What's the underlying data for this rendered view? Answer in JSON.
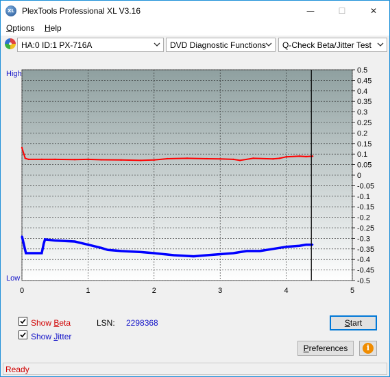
{
  "window": {
    "title": "PlexTools Professional XL V3.16",
    "app_icon_text": "XL",
    "minimize_glyph": "—",
    "maximize_glyph": "☐",
    "close_glyph": "✕"
  },
  "menu": {
    "items": [
      {
        "label": "Options",
        "underline": "O"
      },
      {
        "label": "Help",
        "underline": "H"
      }
    ]
  },
  "toolbar": {
    "drive_combo": "HA:0 ID:1  PX-716A",
    "function_combo": "DVD Diagnostic Functions",
    "test_combo": "Q-Check Beta/Jitter Test"
  },
  "chart_data": {
    "type": "line",
    "title": "",
    "left_axis_labels": {
      "high": "High",
      "low": "Low"
    },
    "x_ticks": [
      "0",
      "1",
      "2",
      "3",
      "4",
      "5"
    ],
    "xlim": [
      0,
      5
    ],
    "y_right_ticks": [
      "0.5",
      "0.45",
      "0.4",
      "0.35",
      "0.3",
      "0.25",
      "0.2",
      "0.15",
      "0.1",
      "0.05",
      "0",
      "-0.05",
      "-0.1",
      "-0.15",
      "-0.2",
      "-0.25",
      "-0.3",
      "-0.35",
      "-0.4",
      "-0.45",
      "-0.5"
    ],
    "ylim": [
      -0.5,
      0.5
    ],
    "grid": true,
    "end_marker_x": 4.38,
    "series": [
      {
        "color": "#ff0000",
        "x": [
          0,
          0.05,
          0.1,
          0.3,
          0.5,
          0.8,
          1.0,
          1.2,
          1.5,
          1.8,
          2.0,
          2.2,
          2.5,
          2.8,
          3.0,
          3.2,
          3.3,
          3.5,
          3.8,
          3.9,
          4.0,
          4.2,
          4.3,
          4.4
        ],
        "y": [
          0.13,
          0.08,
          0.075,
          0.075,
          0.075,
          0.074,
          0.075,
          0.073,
          0.072,
          0.07,
          0.072,
          0.078,
          0.08,
          0.078,
          0.077,
          0.075,
          0.07,
          0.08,
          0.077,
          0.08,
          0.087,
          0.09,
          0.088,
          0.09
        ]
      },
      {
        "color": "#0000ff",
        "x": [
          0,
          0.03,
          0.06,
          0.1,
          0.2,
          0.3,
          0.33,
          0.35,
          0.5,
          0.8,
          1.0,
          1.2,
          1.3,
          1.5,
          1.8,
          2.0,
          2.3,
          2.6,
          2.8,
          3.0,
          3.2,
          3.4,
          3.6,
          3.8,
          4.0,
          4.2,
          4.3,
          4.4
        ],
        "y": [
          -0.29,
          -0.33,
          -0.37,
          -0.37,
          -0.37,
          -0.37,
          -0.325,
          -0.305,
          -0.31,
          -0.315,
          -0.33,
          -0.345,
          -0.355,
          -0.36,
          -0.365,
          -0.37,
          -0.38,
          -0.385,
          -0.38,
          -0.375,
          -0.37,
          -0.36,
          -0.36,
          -0.35,
          -0.34,
          -0.335,
          -0.33,
          -0.33
        ]
      }
    ]
  },
  "bottom": {
    "show_beta_label": "Show Beta",
    "show_beta_underline": "B",
    "show_beta_checked": true,
    "show_jitter_label": "Show Jitter",
    "show_jitter_underline": "J",
    "show_jitter_checked": true,
    "lsn_label": "LSN:",
    "lsn_value": "2298368",
    "start_button": "Start",
    "start_underline": "S",
    "preferences_button": "Preferences",
    "preferences_underline": "P",
    "info_glyph": "i"
  },
  "status": {
    "text": "Ready"
  },
  "colors": {
    "beta": "#ff0000",
    "jitter": "#0000ff",
    "plot_bg_top": "#8fa0a0",
    "plot_bg_bottom": "#ffffff",
    "status_text": "#d00000",
    "accent": "#0078d7"
  }
}
